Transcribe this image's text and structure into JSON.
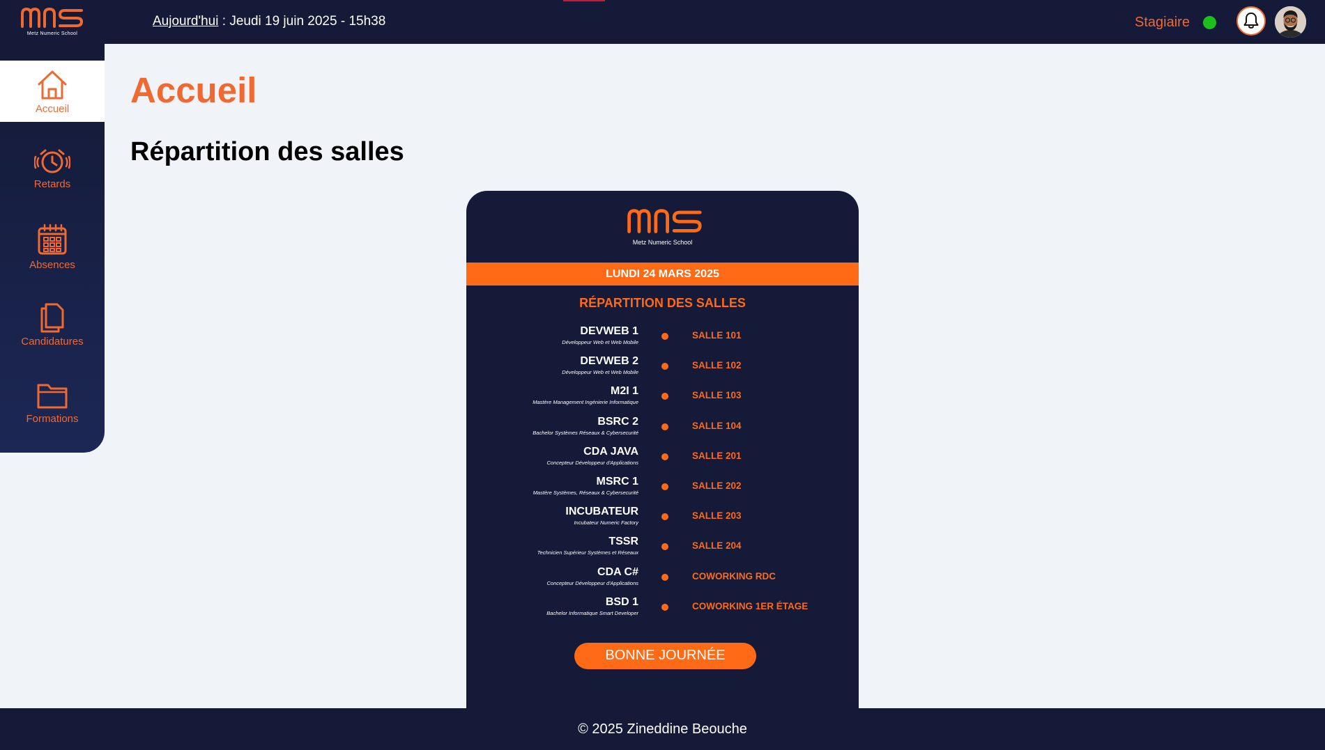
{
  "header": {
    "logo_text": "MNS",
    "logo_subtitle": "Metz Numeric School",
    "today_label": "Aujourd'hui",
    "date_text": " : Jeudi 19 juin 2025 - 15h38",
    "role": "Stagiaire",
    "status_color": "#1dbf1d",
    "notification_icon": "bell-icon"
  },
  "sidebar": {
    "items": [
      {
        "label": "Accueil",
        "icon": "home-icon",
        "active": true
      },
      {
        "label": "Retards",
        "icon": "alarm-clock-icon",
        "active": false
      },
      {
        "label": "Absences",
        "icon": "calendar-icon",
        "active": false
      },
      {
        "label": "Candidatures",
        "icon": "documents-icon",
        "active": false
      },
      {
        "label": "Formations",
        "icon": "folder-icon",
        "active": false
      }
    ]
  },
  "main": {
    "page_title": "Accueil",
    "section_title": "Répartition des salles"
  },
  "poster": {
    "logo_text": "MNS",
    "logo_subtitle": "Metz Numeric School",
    "date": "LUNDI 24 MARS 2025",
    "heading": "RÉPARTITION DES SALLES",
    "rows": [
      {
        "code": "DEVWEB 1",
        "desc": "Développeur Web et Web Mobile",
        "room": "SALLE 101"
      },
      {
        "code": "DEVWEB 2",
        "desc": "Développeur Web et Web Mobile",
        "room": "SALLE 102"
      },
      {
        "code": "M2I 1",
        "desc": "Mastère Management Ingénierie Informatique",
        "room": "SALLE 103"
      },
      {
        "code": "BSRC 2",
        "desc": "Bachelor Systèmes Réseaux & Cybersecurité",
        "room": "SALLE 104"
      },
      {
        "code": "CDA JAVA",
        "desc": "Concepteur Développeur d'Applications",
        "room": "SALLE 201"
      },
      {
        "code": "MSRC 1",
        "desc": "Mastère Systèmes, Réseaux & Cybersecurité",
        "room": "SALLE 202"
      },
      {
        "code": "INCUBATEUR",
        "desc": "Incubateur Numeric Factory",
        "room": "SALLE 203"
      },
      {
        "code": "TSSR",
        "desc": "Technicien Supérieur Systèmes et Réseaux",
        "room": "SALLE 204"
      },
      {
        "code": "CDA C#",
        "desc": "Concepteur Développeur d'Applications",
        "room": "COWORKING RDC"
      },
      {
        "code": "BSD 1",
        "desc": "Bachelor Informatique Smart Developer",
        "room": "COWORKING 1ER ÉTAGE"
      }
    ],
    "closing": "BONNE JOURNÉE"
  },
  "footer": {
    "text": "© 2025 Zineddine Beouche"
  },
  "colors": {
    "navy": "#141a37",
    "accent": "#ef6a32",
    "poster_orange": "#ff6a17",
    "background": "#f0f3f8"
  }
}
